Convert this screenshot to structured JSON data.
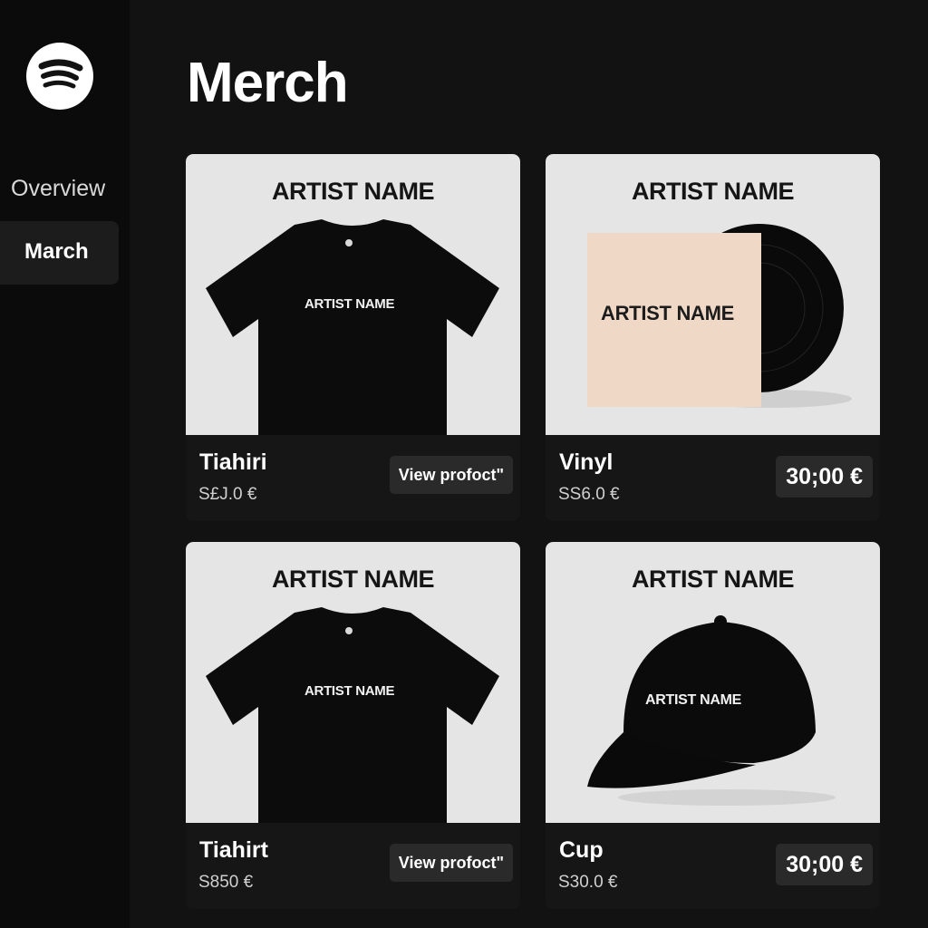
{
  "sidebar": {
    "logo_icon": "spotify-logo-icon",
    "items": [
      {
        "label": "Overview",
        "active": false
      },
      {
        "label": "March",
        "active": true
      }
    ]
  },
  "main": {
    "title": "Merch",
    "products": [
      {
        "brand": "ARTIST NAME",
        "art_label": "ARTIST NAME",
        "name": "Tiahiri",
        "price": "S£J.0 €",
        "action": "View profoct\"",
        "image": "t-shirt"
      },
      {
        "brand": "ARTIST NAME",
        "art_label": "ARTIST NAME",
        "name": "Vinyl",
        "price": "SS6.0 €",
        "action": "30;00 €",
        "image": "vinyl-record"
      },
      {
        "brand": "ARTIST NAME",
        "art_label": "ARTIST NAME",
        "name": "Tiahirt",
        "price": "S850 €",
        "action": "View profoct\"",
        "image": "t-shirt"
      },
      {
        "brand": "ARTIST NAME",
        "art_label": "ARTIST NAME",
        "name": "Cup",
        "price": "S30.0 €",
        "action": "30;00 €",
        "image": "baseball-cap"
      }
    ]
  },
  "colors": {
    "background": "#121212",
    "sidebar": "#0b0b0b",
    "card_image_bg": "#e5e5e5",
    "button_bg": "#2a2a2a",
    "vinyl_sleeve": "#efd8c6"
  }
}
